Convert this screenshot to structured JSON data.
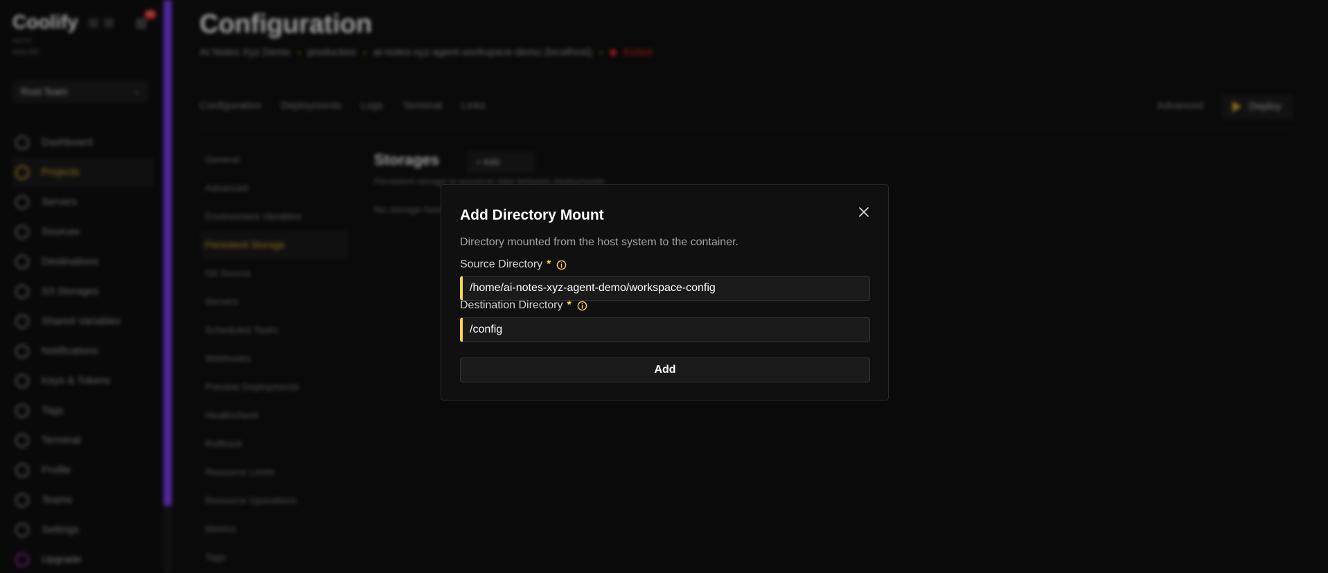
{
  "sidebar": {
    "brand": "Coolify",
    "notification_count": "99",
    "version_line1": "v4.0.0",
    "version_line2": "beta.400",
    "team": "Root Team",
    "items": [
      {
        "label": "Dashboard"
      },
      {
        "label": "Projects"
      },
      {
        "label": "Servers"
      },
      {
        "label": "Sources"
      },
      {
        "label": "Destinations"
      },
      {
        "label": "S3 Storages"
      },
      {
        "label": "Shared Variables"
      },
      {
        "label": "Notifications"
      },
      {
        "label": "Keys & Tokens"
      },
      {
        "label": "Tags"
      },
      {
        "label": "Terminal"
      },
      {
        "label": "Profile"
      },
      {
        "label": "Teams"
      },
      {
        "label": "Settings"
      },
      {
        "label": "Upgrade"
      }
    ]
  },
  "header": {
    "title": "Configuration",
    "breadcrumb": {
      "project": "AI Notes Xyz Demo",
      "environment": "production",
      "resource": "ai-notes-xyz-agent-workspace-demo (localhost)",
      "status": "Exited"
    },
    "tabs": [
      "Configuration",
      "Deployments",
      "Logs",
      "Terminal",
      "Links"
    ],
    "advanced_label": "Advanced",
    "deploy_label": "Deploy"
  },
  "sub_nav": [
    "General",
    "Advanced",
    "Environment Variables",
    "Persistent Storage",
    "Git Source",
    "Servers",
    "Scheduled Tasks",
    "Webhooks",
    "Preview Deployments",
    "Healthcheck",
    "Rollback",
    "Resource Limits",
    "Resource Operations",
    "Metrics",
    "Tags"
  ],
  "storages": {
    "title": "Storages",
    "add_label": "+ Add",
    "subtitle": "Persistent storage to preserve data between deployments.",
    "empty": "No storage found."
  },
  "modal": {
    "title": "Add Directory Mount",
    "description": "Directory mounted from the host system to the container.",
    "source_label": "Source Directory",
    "source_value": "/home/ai-notes-xyz-agent-demo/workspace-config",
    "destination_label": "Destination Directory",
    "destination_value": "/config",
    "required_mark": "*",
    "submit_label": "Add"
  },
  "colors": {
    "accent": "#fcd34d",
    "brand_purple": "#7c3aed",
    "danger": "#dc2626"
  }
}
